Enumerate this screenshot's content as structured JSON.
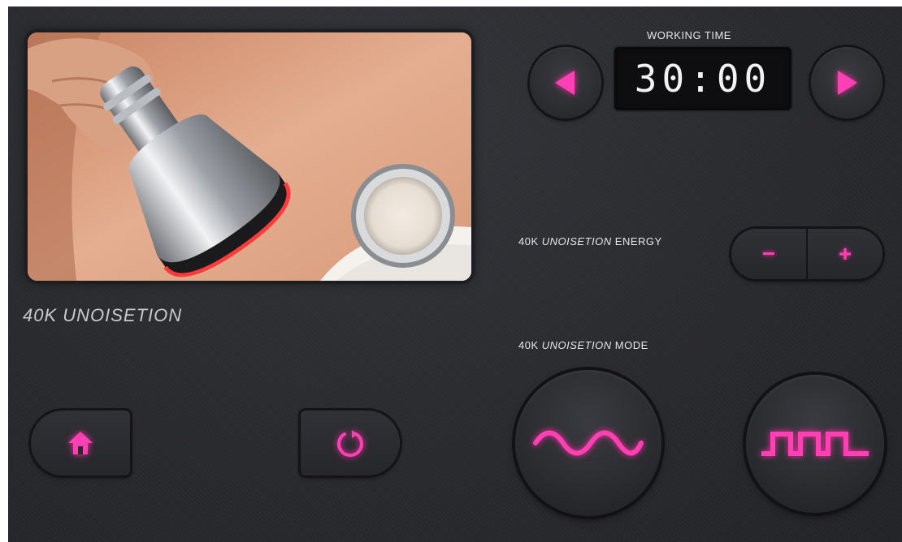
{
  "device": {
    "name": "40K UNOISETION"
  },
  "working_time": {
    "label": "WORKING TIME",
    "value": "30:00"
  },
  "energy": {
    "label_prefix": "40K ",
    "label_italic": "UNOISETION",
    "label_suffix": " ENERGY",
    "minus_label": "−",
    "plus_label": "+"
  },
  "mode": {
    "label_prefix": "40K ",
    "label_italic": "UNOISETION",
    "label_suffix": " MODE"
  },
  "icons": {
    "prev": "triangle-left-icon",
    "next": "triangle-right-icon",
    "home": "home-icon",
    "reset": "refresh-icon",
    "sine": "sine-wave-icon",
    "square": "square-wave-icon"
  },
  "colors": {
    "accent": "#ff2aa6",
    "panel": "#2a2b2f"
  }
}
